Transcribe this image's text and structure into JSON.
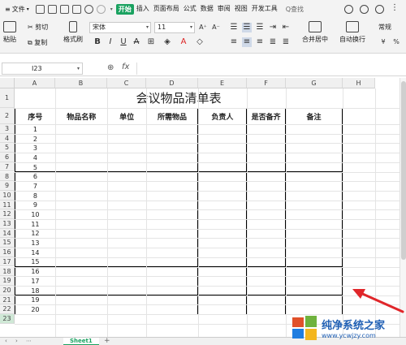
{
  "menubar": {
    "file": "文件",
    "tabs": [
      "开始",
      "插入",
      "页面布局",
      "公式",
      "数据",
      "审阅",
      "视图",
      "开发工具"
    ],
    "active_tab": "开始",
    "search": "Q查找"
  },
  "ribbon": {
    "paste": "粘贴",
    "cut": "剪切",
    "copy": "复制",
    "format_painter": "格式刷",
    "font_name": "宋体",
    "font_size": "11",
    "merge_center": "合并居中",
    "wrap_text": "自动换行",
    "number_format": "常规"
  },
  "formula_bar": {
    "cell_ref": "I23",
    "fx": "fx",
    "value": ""
  },
  "grid": {
    "columns": [
      "A",
      "B",
      "C",
      "D",
      "E",
      "F",
      "G",
      "H"
    ],
    "rows": [
      "1",
      "2",
      "3",
      "4",
      "5",
      "6",
      "7",
      "8",
      "9",
      "10",
      "11",
      "12",
      "13",
      "14",
      "15",
      "16",
      "17",
      "18",
      "19",
      "20",
      "21",
      "22",
      "23"
    ],
    "title": "会议物品清单表",
    "headers": [
      "序号",
      "物品名称",
      "单位",
      "所需物品",
      "负责人",
      "是否备齐",
      "备注"
    ],
    "serials": [
      "1",
      "2",
      "3",
      "4",
      "5",
      "6",
      "7",
      "8",
      "9",
      "10",
      "11",
      "12",
      "13",
      "14",
      "15",
      "16",
      "17",
      "18",
      "19",
      "20"
    ]
  },
  "sheets": {
    "active": "Sheet1",
    "add": "+"
  },
  "watermark": {
    "brand": "纯净系统之家",
    "url": "www.ycwjzy.com"
  },
  "colors": {
    "accent_green": "#1aa260",
    "arrow_red": "#e0262a",
    "brand_blue": "#1f5fb4"
  }
}
